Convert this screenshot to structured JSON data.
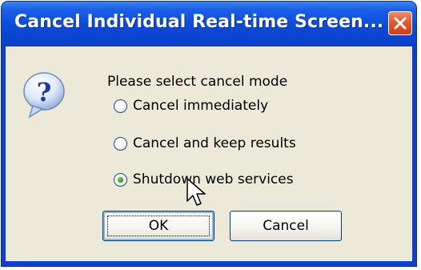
{
  "dialog": {
    "title": "Cancel Individual Real-time Screen...",
    "prompt": "Please select cancel mode",
    "icon": "question-icon",
    "options": [
      {
        "label": "Cancel immediately",
        "selected": false
      },
      {
        "label": "Cancel and keep results",
        "selected": false
      },
      {
        "label": "Shutdown web services",
        "selected": true
      }
    ],
    "buttons": {
      "ok_label": "OK",
      "cancel_label": "Cancel"
    }
  },
  "colors": {
    "titlebar": "#0a44cf",
    "close_button": "#e45a2c",
    "client_background": "#ece9d8",
    "radio_selected_dot": "#2f9a25"
  }
}
